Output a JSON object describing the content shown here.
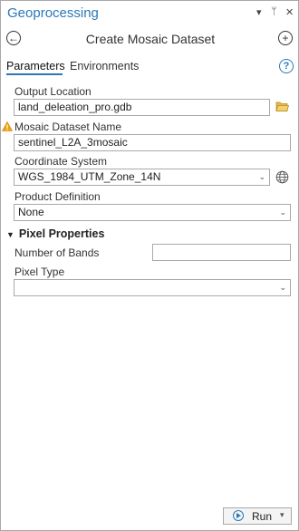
{
  "pane": {
    "title": "Geoprocessing",
    "menu_icon": "▾",
    "pin_icon": "ᛘ",
    "close_icon": "✕"
  },
  "tool": {
    "back_icon": "←",
    "title": "Create Mosaic Dataset",
    "add_icon": "+"
  },
  "tabs": [
    {
      "label": "Parameters",
      "active": true
    },
    {
      "label": "Environments",
      "active": false
    }
  ],
  "help_icon": "?",
  "params": {
    "output_location": {
      "label": "Output Location",
      "value": "land_deleation_pro.gdb",
      "browse_icon": "folder-icon"
    },
    "mosaic_name": {
      "label": "Mosaic Dataset Name",
      "value": "sentinel_L2A_3mosaic",
      "warning_icon": "⚠"
    },
    "coordinate_system": {
      "label": "Coordinate System",
      "value": "WGS_1984_UTM_Zone_14N",
      "globe_icon": "globe-icon"
    },
    "product_definition": {
      "label": "Product Definition",
      "value": "None"
    }
  },
  "pixel_properties": {
    "title": "Pixel Properties",
    "number_of_bands": {
      "label": "Number of Bands",
      "value": ""
    },
    "pixel_type": {
      "label": "Pixel Type",
      "value": ""
    }
  },
  "run": {
    "label": "Run",
    "dropdown_icon": "▾"
  },
  "colors": {
    "accent": "#2b78b8",
    "warning": "#f0a30a",
    "folder": "#e8b84a"
  }
}
